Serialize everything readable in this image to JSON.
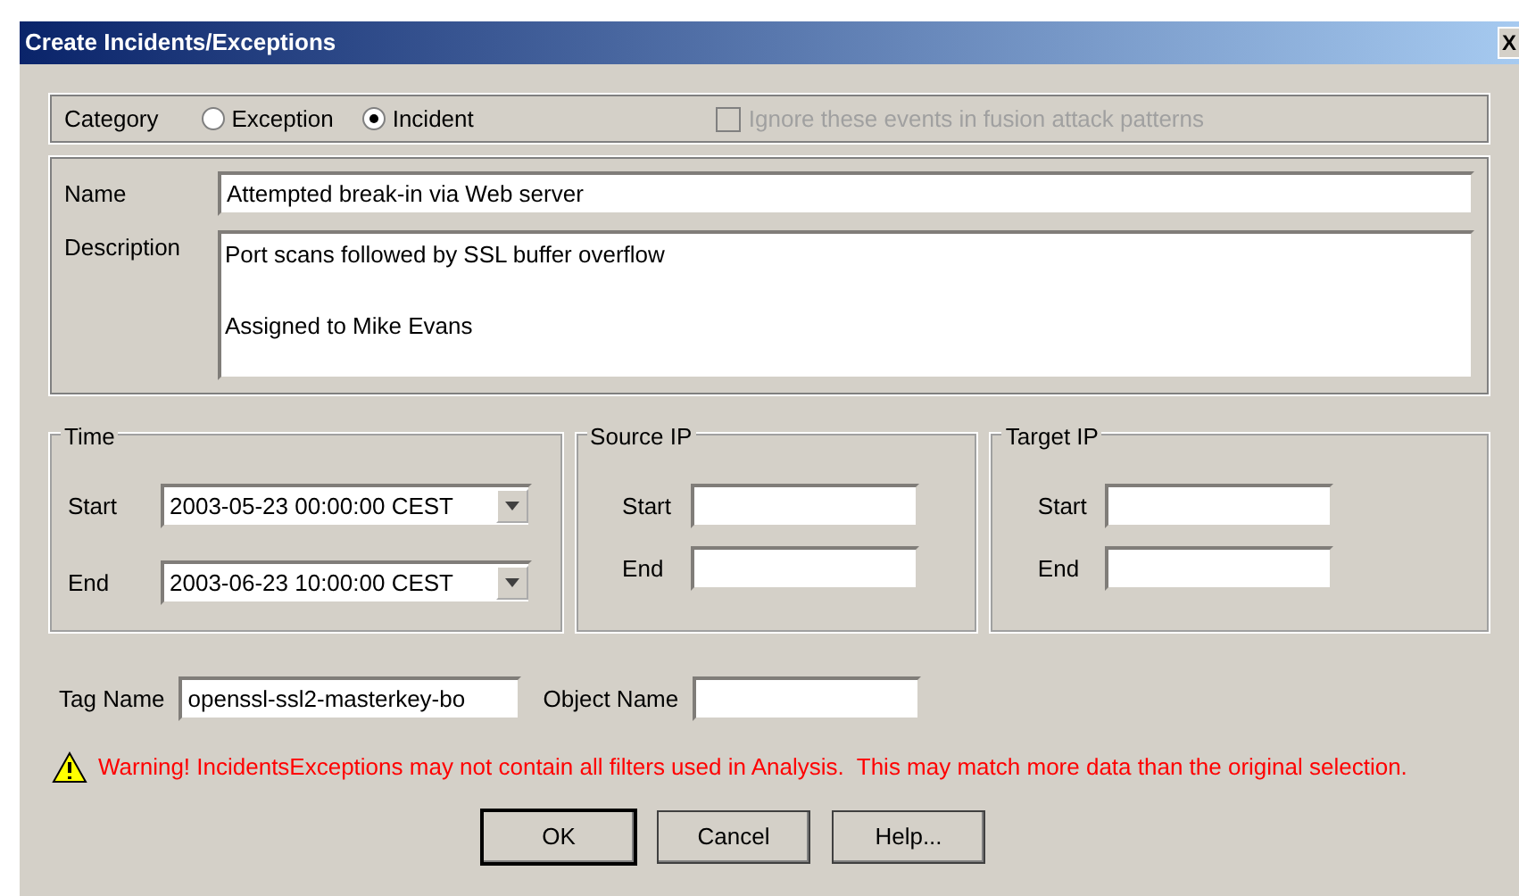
{
  "window": {
    "title": "Create Incidents/Exceptions",
    "close": "X"
  },
  "category": {
    "label": "Category",
    "options": [
      {
        "label": "Exception",
        "selected": false
      },
      {
        "label": "Incident",
        "selected": true
      }
    ],
    "ignore_checkbox": {
      "label": "Ignore these events in fusion attack patterns",
      "checked": false,
      "disabled": true
    }
  },
  "name": {
    "label": "Name",
    "value": "Attempted break-in via Web server"
  },
  "description": {
    "label": "Description",
    "value": "Port scans followed by SSL buffer overflow\n\nAssigned to Mike Evans"
  },
  "ranges": [
    {
      "title": "Time",
      "kind": "dropdown",
      "start_label": "Start",
      "start": "2003-05-23 00:00:00 CEST",
      "end_label": "End",
      "end": "2003-06-23 10:00:00 CEST"
    },
    {
      "title": "Source IP",
      "kind": "text",
      "start_label": "Start",
      "end_label": "End"
    },
    {
      "title": "Target IP",
      "kind": "text",
      "start_label": "Start",
      "end_label": "End"
    }
  ],
  "tag_name": {
    "label": "Tag Name",
    "value": "openssl-ssl2-masterkey-bo"
  },
  "object_name": {
    "label": "Object Name"
  },
  "warning": "Warning! IncidentsExceptions may not contain all filters used in Analysis.  This may match more data than the original selection.",
  "buttons": [
    {
      "label": "OK",
      "default": true
    },
    {
      "label": "Cancel",
      "default": false
    },
    {
      "label": "Help...",
      "default": false
    }
  ]
}
